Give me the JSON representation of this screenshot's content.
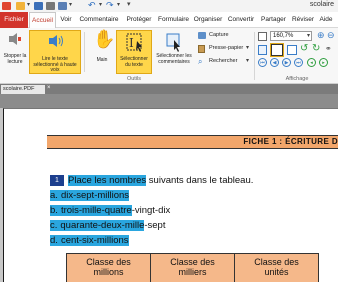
{
  "window": {
    "title": "scolaire"
  },
  "quick_access": {
    "icons": [
      "app-logo-icon",
      "open-folder-icon",
      "save-icon",
      "print-icon",
      "email-icon",
      "undo-icon",
      "redo-icon",
      "customize-dropdown-icon"
    ]
  },
  "menu": {
    "file": "Fichier",
    "items": [
      "Accueil",
      "Voir",
      "Commentaire",
      "Protéger",
      "Formulaire",
      "Organiser",
      "Convertir",
      "Partager",
      "Réviser",
      "Aide"
    ],
    "active": "Accueil"
  },
  "ribbon": {
    "stop_reading": "Stopper la lecture",
    "read_selected": "Lire le texte sélectionné à haute voix",
    "hand": "Main",
    "select_text": "Sélectionner du texte",
    "select_annotations": "Sélectionner les commentaires",
    "capture": "Capture",
    "clipboard": "Presse-papier",
    "search": "Rechercher",
    "tools_group": "Outils",
    "zoom_value": "160,7%",
    "display_group": "Affichage"
  },
  "doc_tab": {
    "label": "scolaire.PDF",
    "close": "×"
  },
  "document": {
    "fiche_title": "FICHE 1 : ÉCRITURE D",
    "exercise_number": "1",
    "instruction_selected": "Place les nombres",
    "instruction_rest": " suivants dans le tableau.",
    "items": [
      {
        "letter": "a.",
        "selected": "dix-sept-millions",
        "rest": ""
      },
      {
        "letter": "b.",
        "selected": "trois-mille-quatre",
        "rest": "-vingt-dix"
      },
      {
        "letter": "c.",
        "selected": "quarante-deux-mille",
        "rest": "-sept"
      },
      {
        "letter": "d.",
        "selected": "cent-six-millions",
        "rest": ""
      }
    ],
    "table_headers": [
      {
        "line1": "Classe des",
        "line2": "millions"
      },
      {
        "line1": "Classe des",
        "line2": "milliers"
      },
      {
        "line1": "Classe des",
        "line2": "unités"
      }
    ]
  },
  "colors": {
    "accent": "#d2342b",
    "selection": "#2aa6df",
    "fiche_band": "#f2a66b",
    "table_header": "#f5b88a",
    "highlight": "#ffd64a"
  }
}
